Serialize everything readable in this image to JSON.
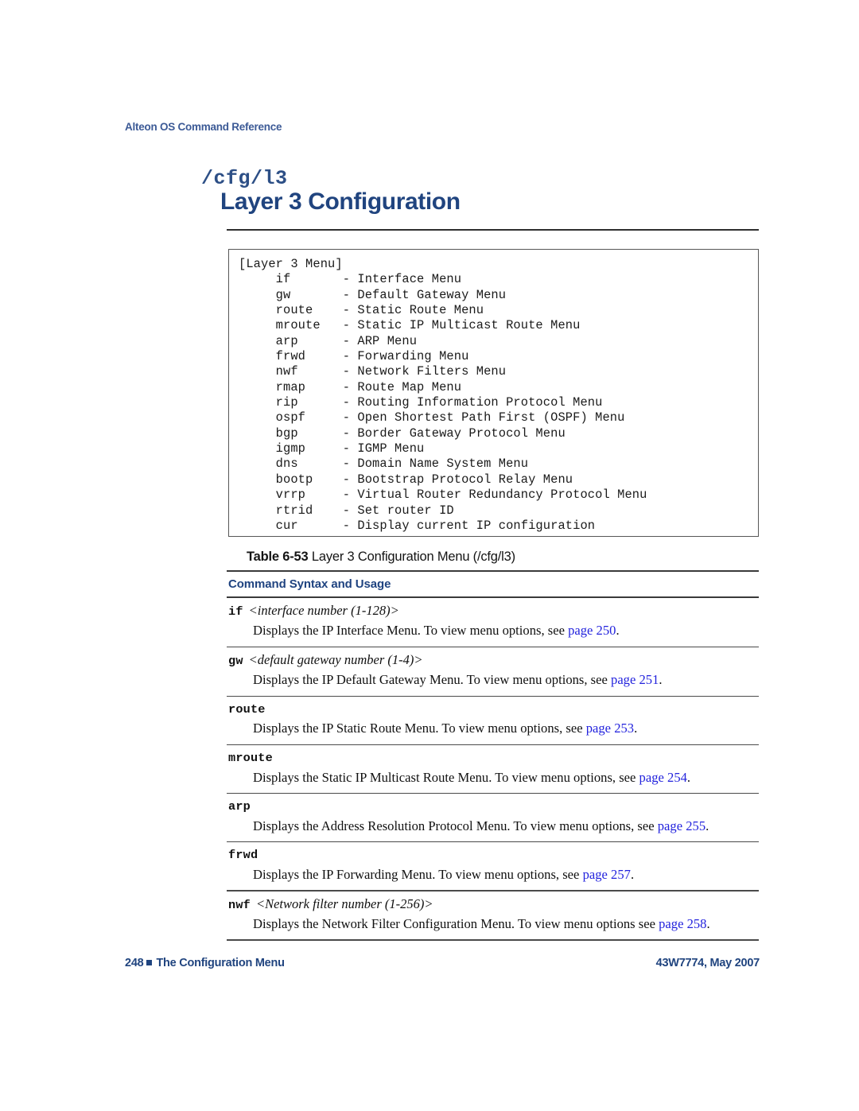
{
  "running_header": "Alteon OS Command Reference",
  "title": {
    "command_path": "/cfg/l3",
    "heading": "Layer 3 Configuration"
  },
  "menu_box": {
    "title_line": "[Layer 3 Menu]",
    "text": "[Layer 3 Menu]\n     if       - Interface Menu\n     gw       - Default Gateway Menu\n     route    - Static Route Menu\n     mroute   - Static IP Multicast Route Menu\n     arp      - ARP Menu\n     frwd     - Forwarding Menu\n     nwf      - Network Filters Menu\n     rmap     - Route Map Menu\n     rip      - Routing Information Protocol Menu\n     ospf     - Open Shortest Path First (OSPF) Menu\n     bgp      - Border Gateway Protocol Menu\n     igmp     - IGMP Menu\n     dns      - Domain Name System Menu\n     bootp    - Bootstrap Protocol Relay Menu\n     vrrp     - Virtual Router Redundancy Protocol Menu\n     rtrid    - Set router ID\n     cur      - Display current IP configuration",
    "entries": [
      {
        "command": "if",
        "description": "Interface Menu"
      },
      {
        "command": "gw",
        "description": "Default Gateway Menu"
      },
      {
        "command": "route",
        "description": "Static Route Menu"
      },
      {
        "command": "mroute",
        "description": "Static IP Multicast Route Menu"
      },
      {
        "command": "arp",
        "description": "ARP Menu"
      },
      {
        "command": "frwd",
        "description": "Forwarding Menu"
      },
      {
        "command": "nwf",
        "description": "Network Filters Menu"
      },
      {
        "command": "rmap",
        "description": "Route Map Menu"
      },
      {
        "command": "rip",
        "description": "Routing Information Protocol Menu"
      },
      {
        "command": "ospf",
        "description": "Open Shortest Path First (OSPF) Menu"
      },
      {
        "command": "bgp",
        "description": "Border Gateway Protocol Menu"
      },
      {
        "command": "igmp",
        "description": "IGMP Menu"
      },
      {
        "command": "dns",
        "description": "Domain Name System Menu"
      },
      {
        "command": "bootp",
        "description": "Bootstrap Protocol Relay Menu"
      },
      {
        "command": "vrrp",
        "description": "Virtual Router Redundancy Protocol Menu"
      },
      {
        "command": "rtrid",
        "description": "Set router ID"
      },
      {
        "command": "cur",
        "description": "Display current IP configuration"
      }
    ]
  },
  "table": {
    "caption_label": "Table 6-53",
    "caption_text": "Layer 3 Configuration Menu (/cfg/l3)",
    "column_header": "Command Syntax and Usage",
    "rows": [
      {
        "term": "if",
        "param": "<interface number (1-128)>",
        "desc_before": "Displays the IP Interface Menu. To view menu options, see ",
        "link": "page 250",
        "desc_after": "."
      },
      {
        "term": "gw",
        "param": "<default gateway number (1-4)>",
        "desc_before": "Displays the IP Default Gateway Menu. To view menu options, see ",
        "link": "page 251",
        "desc_after": "."
      },
      {
        "term": "route",
        "param": "",
        "desc_before": "Displays the IP Static Route Menu. To view menu options, see ",
        "link": "page 253",
        "desc_after": "."
      },
      {
        "term": "mroute",
        "param": "",
        "desc_before": "Displays the Static IP Multicast Route Menu. To view menu options, see ",
        "link": "page 254",
        "desc_after": "."
      },
      {
        "term": "arp",
        "param": "",
        "desc_before": "Displays the Address Resolution Protocol Menu. To view menu options, see ",
        "link": "page 255",
        "desc_after": "."
      },
      {
        "term": "frwd",
        "param": "",
        "desc_before": "Displays the IP Forwarding Menu. To view menu options, see ",
        "link": "page 257",
        "desc_after": "."
      },
      {
        "term": "nwf",
        "param": "<Network filter number (1-256)>",
        "desc_before": "Displays the Network Filter Configuration Menu. To view menu options see ",
        "link": "page 258",
        "desc_after": "."
      }
    ]
  },
  "footer": {
    "page_number": "248",
    "section": "The Configuration Menu",
    "doc_id": "43W7774, May 2007"
  },
  "colors": {
    "title_navy": "#20447f",
    "header_blue": "#3c5a96",
    "link_blue": "#2222dd",
    "rule_dark": "#3a3a3a"
  }
}
